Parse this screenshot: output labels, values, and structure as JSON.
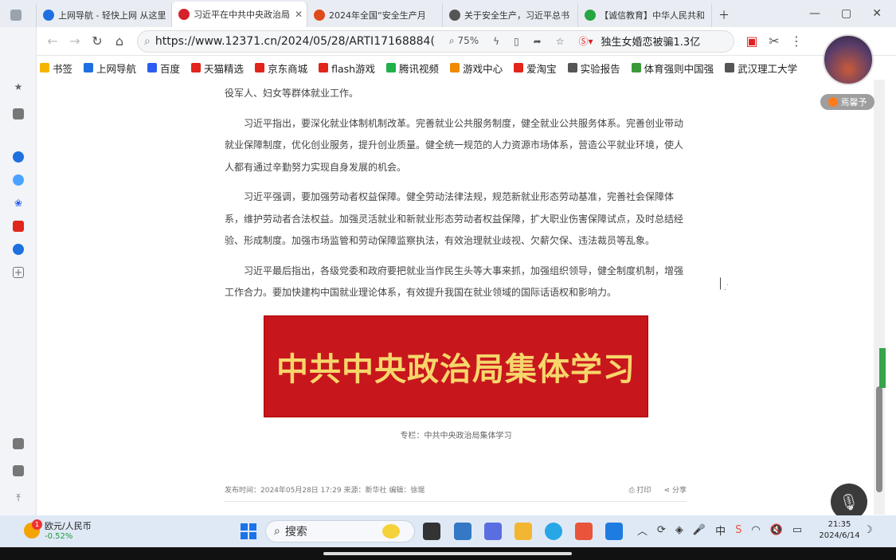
{
  "tabs": [
    {
      "label": "上网导航 - 轻快上网 从这里",
      "color": "#1e6fe0"
    },
    {
      "label": "习近平在中共中央政治局",
      "color": "#d3222a",
      "active": true
    },
    {
      "label": "2024年全国“安全生产月",
      "color": "#e04a1b"
    },
    {
      "label": "关于安全生产，习近平总书",
      "color": "#555555"
    },
    {
      "label": "【诚信教育】中华人民共和",
      "color": "#26a641"
    }
  ],
  "browser": {
    "url": "https://www.12371.cn/2024/05/28/ARTI17168884(",
    "zoom": "75%",
    "news_ticker": "独生女婚恋被骗1.3亿"
  },
  "bookmarks": [
    {
      "label": "书签",
      "color": "#f5b400"
    },
    {
      "label": "上网导航",
      "color": "#1e6fe0"
    },
    {
      "label": "百度",
      "color": "#2b5ef0"
    },
    {
      "label": "天猫精选",
      "color": "#e1251b"
    },
    {
      "label": "京东商城",
      "color": "#e1251b"
    },
    {
      "label": "flash游戏",
      "color": "#e1251b"
    },
    {
      "label": "腾讯视频",
      "color": "#20b14a"
    },
    {
      "label": "游戏中心",
      "color": "#f08a00"
    },
    {
      "label": "爱淘宝",
      "color": "#e1251b"
    },
    {
      "label": "实验报告",
      "color": "#555555"
    },
    {
      "label": "体育强则中国强",
      "color": "#3a9a3a"
    },
    {
      "label": "武汉理工大学",
      "color": "#555555"
    }
  ],
  "article": {
    "paragraphs": [
      "役军人、妇女等群体就业工作。",
      "习近平指出，要深化就业体制机制改革。完善就业公共服务制度，健全就业公共服务体系。完善创业带动就业保障制度，优化创业服务，提升创业质量。健全统一规范的人力资源市场体系，营造公平就业环境，使人人都有通过辛勤努力实现自身发展的机会。",
      "习近平强调，要加强劳动者权益保障。健全劳动法律法规，规范新就业形态劳动基准，完善社会保障体系，维护劳动者合法权益。加强灵活就业和新就业形态劳动者权益保障，扩大职业伤害保障试点，及时总结经验、形成制度。加强市场监管和劳动保障监察执法，有效治理就业歧视、欠薪欠保、违法裁员等乱象。",
      "习近平最后指出，各级党委和政府要把就业当作民生头等大事来抓，加强组织领导，健全制度机制，增强工作合力。要加快建构中国就业理论体系，有效提升我国在就业领域的国际话语权和影响力。"
    ],
    "banner_text": "中共中央政治局集体学习",
    "caption": "专栏：中共中央政治局集体学习",
    "meta": "发布时间：2024年05月28日 17:29 来源：新华社 编辑：徐琨",
    "print_label": "打印",
    "share_label": "分享"
  },
  "user": {
    "name": "焉馨予"
  },
  "taskbar": {
    "currency_label": "欧元/人民币",
    "currency_change": "-0.52%",
    "badge": "1",
    "search_label": "搜索",
    "time": "21:35",
    "date": "2024/6/14"
  }
}
